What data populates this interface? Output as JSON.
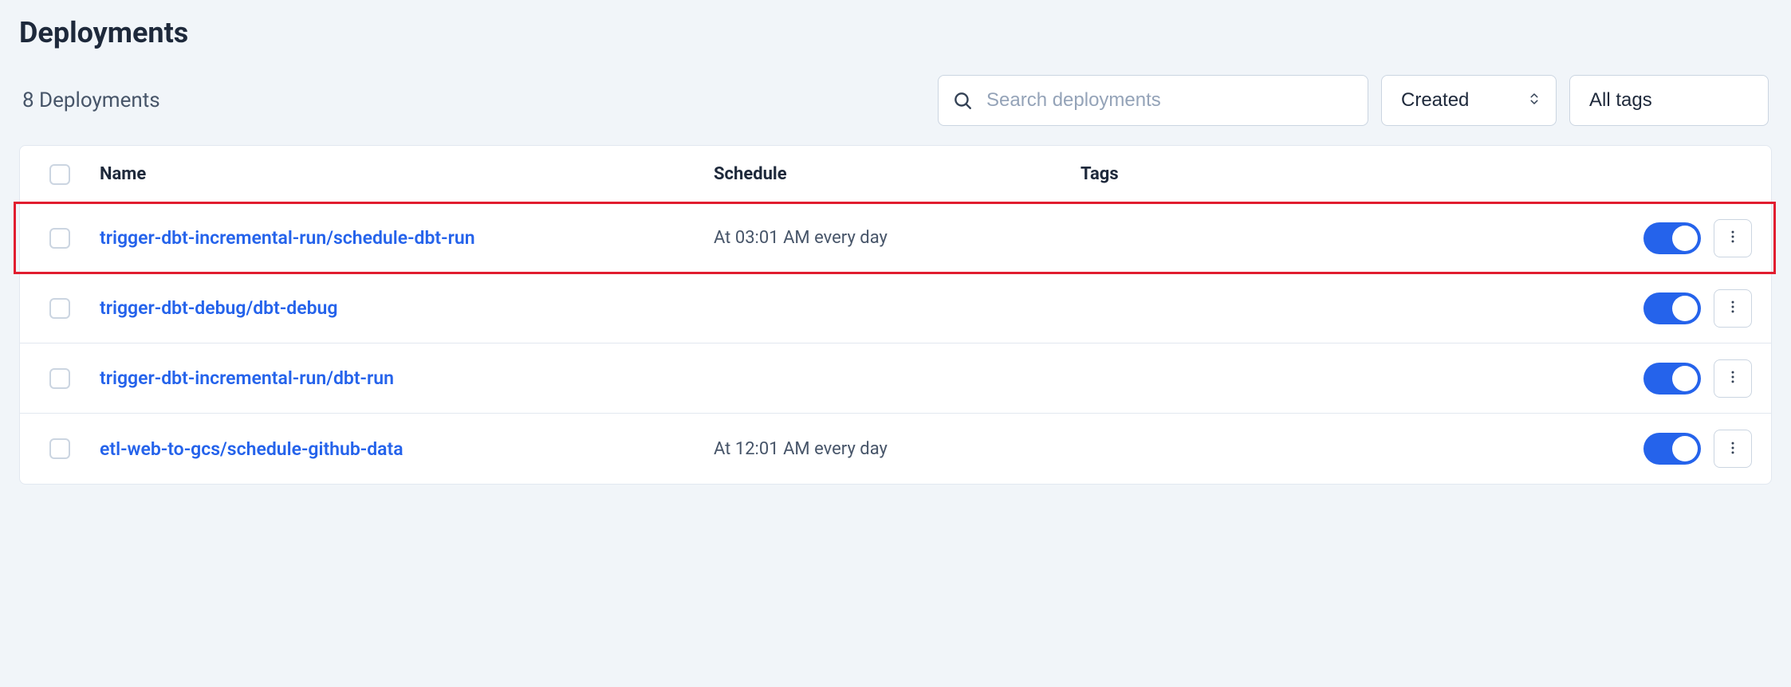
{
  "header": {
    "title": "Deployments"
  },
  "summary": {
    "count_text": "8 Deployments"
  },
  "search": {
    "placeholder": "Search deployments"
  },
  "sort": {
    "label": "Created"
  },
  "tags_filter": {
    "label": "All tags"
  },
  "columns": {
    "name": "Name",
    "schedule": "Schedule",
    "tags": "Tags"
  },
  "rows": [
    {
      "flow": "trigger-dbt-incremental-run",
      "deployment": "schedule-dbt-run",
      "schedule": "At 03:01 AM every day",
      "enabled": true,
      "highlighted": true
    },
    {
      "flow": "trigger-dbt-debug",
      "deployment": "dbt-debug",
      "schedule": "",
      "enabled": true,
      "highlighted": false
    },
    {
      "flow": "trigger-dbt-incremental-run",
      "deployment": "dbt-run",
      "schedule": "",
      "enabled": true,
      "highlighted": false
    },
    {
      "flow": "etl-web-to-gcs",
      "deployment": "schedule-github-data",
      "schedule": "At 12:01 AM every day",
      "enabled": true,
      "highlighted": false
    }
  ]
}
